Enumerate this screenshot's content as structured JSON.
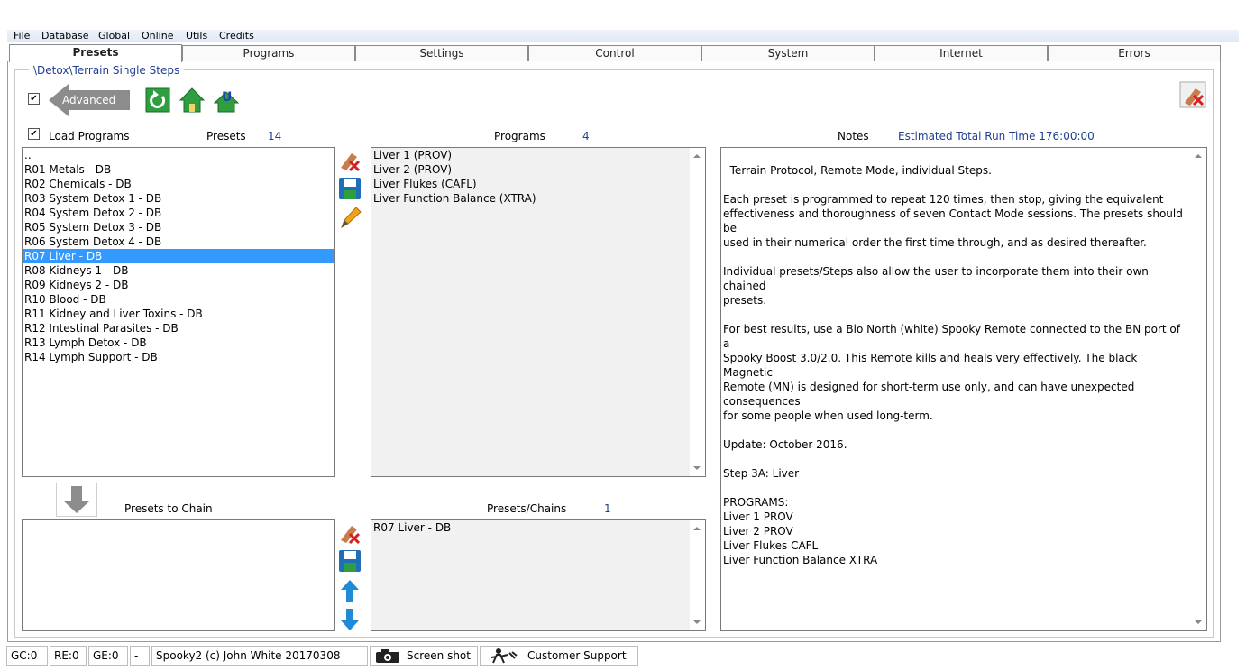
{
  "menu": [
    "File",
    "Database",
    "Global",
    "Online",
    "Utils",
    "Credits"
  ],
  "tabs": [
    "Presets",
    "Programs",
    "Settings",
    "Control",
    "System",
    "Internet",
    "Errors"
  ],
  "active_tab": "Presets",
  "breadcrumb": "\\Detox\\Terrain Single Steps",
  "advanced_label": "Advanced",
  "advanced_checked": "✔",
  "load_programs": {
    "checked": "✔",
    "label": "Load Programs"
  },
  "presets": {
    "label": "Presets",
    "count": "14",
    "items": [
      "..",
      "R01 Metals - DB",
      "R02 Chemicals - DB",
      "R03 System Detox 1 - DB",
      "R04 System Detox 2 - DB",
      "R05 System Detox 3 - DB",
      "R06 System Detox 4 - DB",
      "R07 Liver - DB",
      "R08 Kidneys 1 - DB",
      "R09 Kidneys 2 - DB",
      "R10 Blood - DB",
      "R11 Kidney and Liver Toxins - DB",
      "R12 Intestinal Parasites - DB",
      "R13 Lymph Detox - DB",
      "R14 Lymph Support - DB"
    ],
    "selected": "R07 Liver - DB"
  },
  "programs": {
    "label": "Programs",
    "count": "4",
    "items": [
      "Liver 1 (PROV)",
      "Liver 2 (PROV)",
      "Liver Flukes (CAFL)",
      "Liver Function Balance (XTRA)"
    ]
  },
  "notes": {
    "label": "Notes",
    "run_time": "Estimated Total Run Time 176:00:00",
    "text": "Terrain Protocol, Remote Mode, individual Steps.\n\nEach preset is programmed to repeat 120 times, then stop, giving the equivalent\neffectiveness and thoroughness of seven Contact Mode sessions. The presets should be\nused in their numerical order the first time through, and as desired thereafter.\n\nIndividual presets/Steps also allow the user to incorporate them into their own chained\npresets.\n\nFor best results, use a Bio North (white) Spooky Remote connected to the BN port of a\nSpooky Boost 3.0/2.0. This Remote kills and heals very effectively. The black Magnetic\nRemote (MN) is designed for short-term use only, and can have unexpected consequences\nfor some people when used long-term.\n\nUpdate: October 2016.\n\nStep 3A: Liver\n\nPROGRAMS:\nLiver 1 PROV\nLiver 2 PROV\nLiver Flukes CAFL\nLiver Function Balance XTRA"
  },
  "presets_to_chain": {
    "label": "Presets to Chain",
    "items": []
  },
  "presets_chains": {
    "label": "Presets/Chains",
    "count": "1",
    "items": [
      "R07 Liver - DB"
    ]
  },
  "status": {
    "gc": "GC:0",
    "re": "RE:0",
    "ge": "GE:0",
    "dash": "-",
    "copyright": "Spooky2 (c) John White 20170308",
    "screenshot": "Screen shot",
    "support": "Customer Support"
  },
  "colors": {
    "selection": "#3399ff",
    "label_blue": "#1f3f8f",
    "arrow_gray": "#8c8c8c",
    "icon_green": "#2e9e3e"
  }
}
